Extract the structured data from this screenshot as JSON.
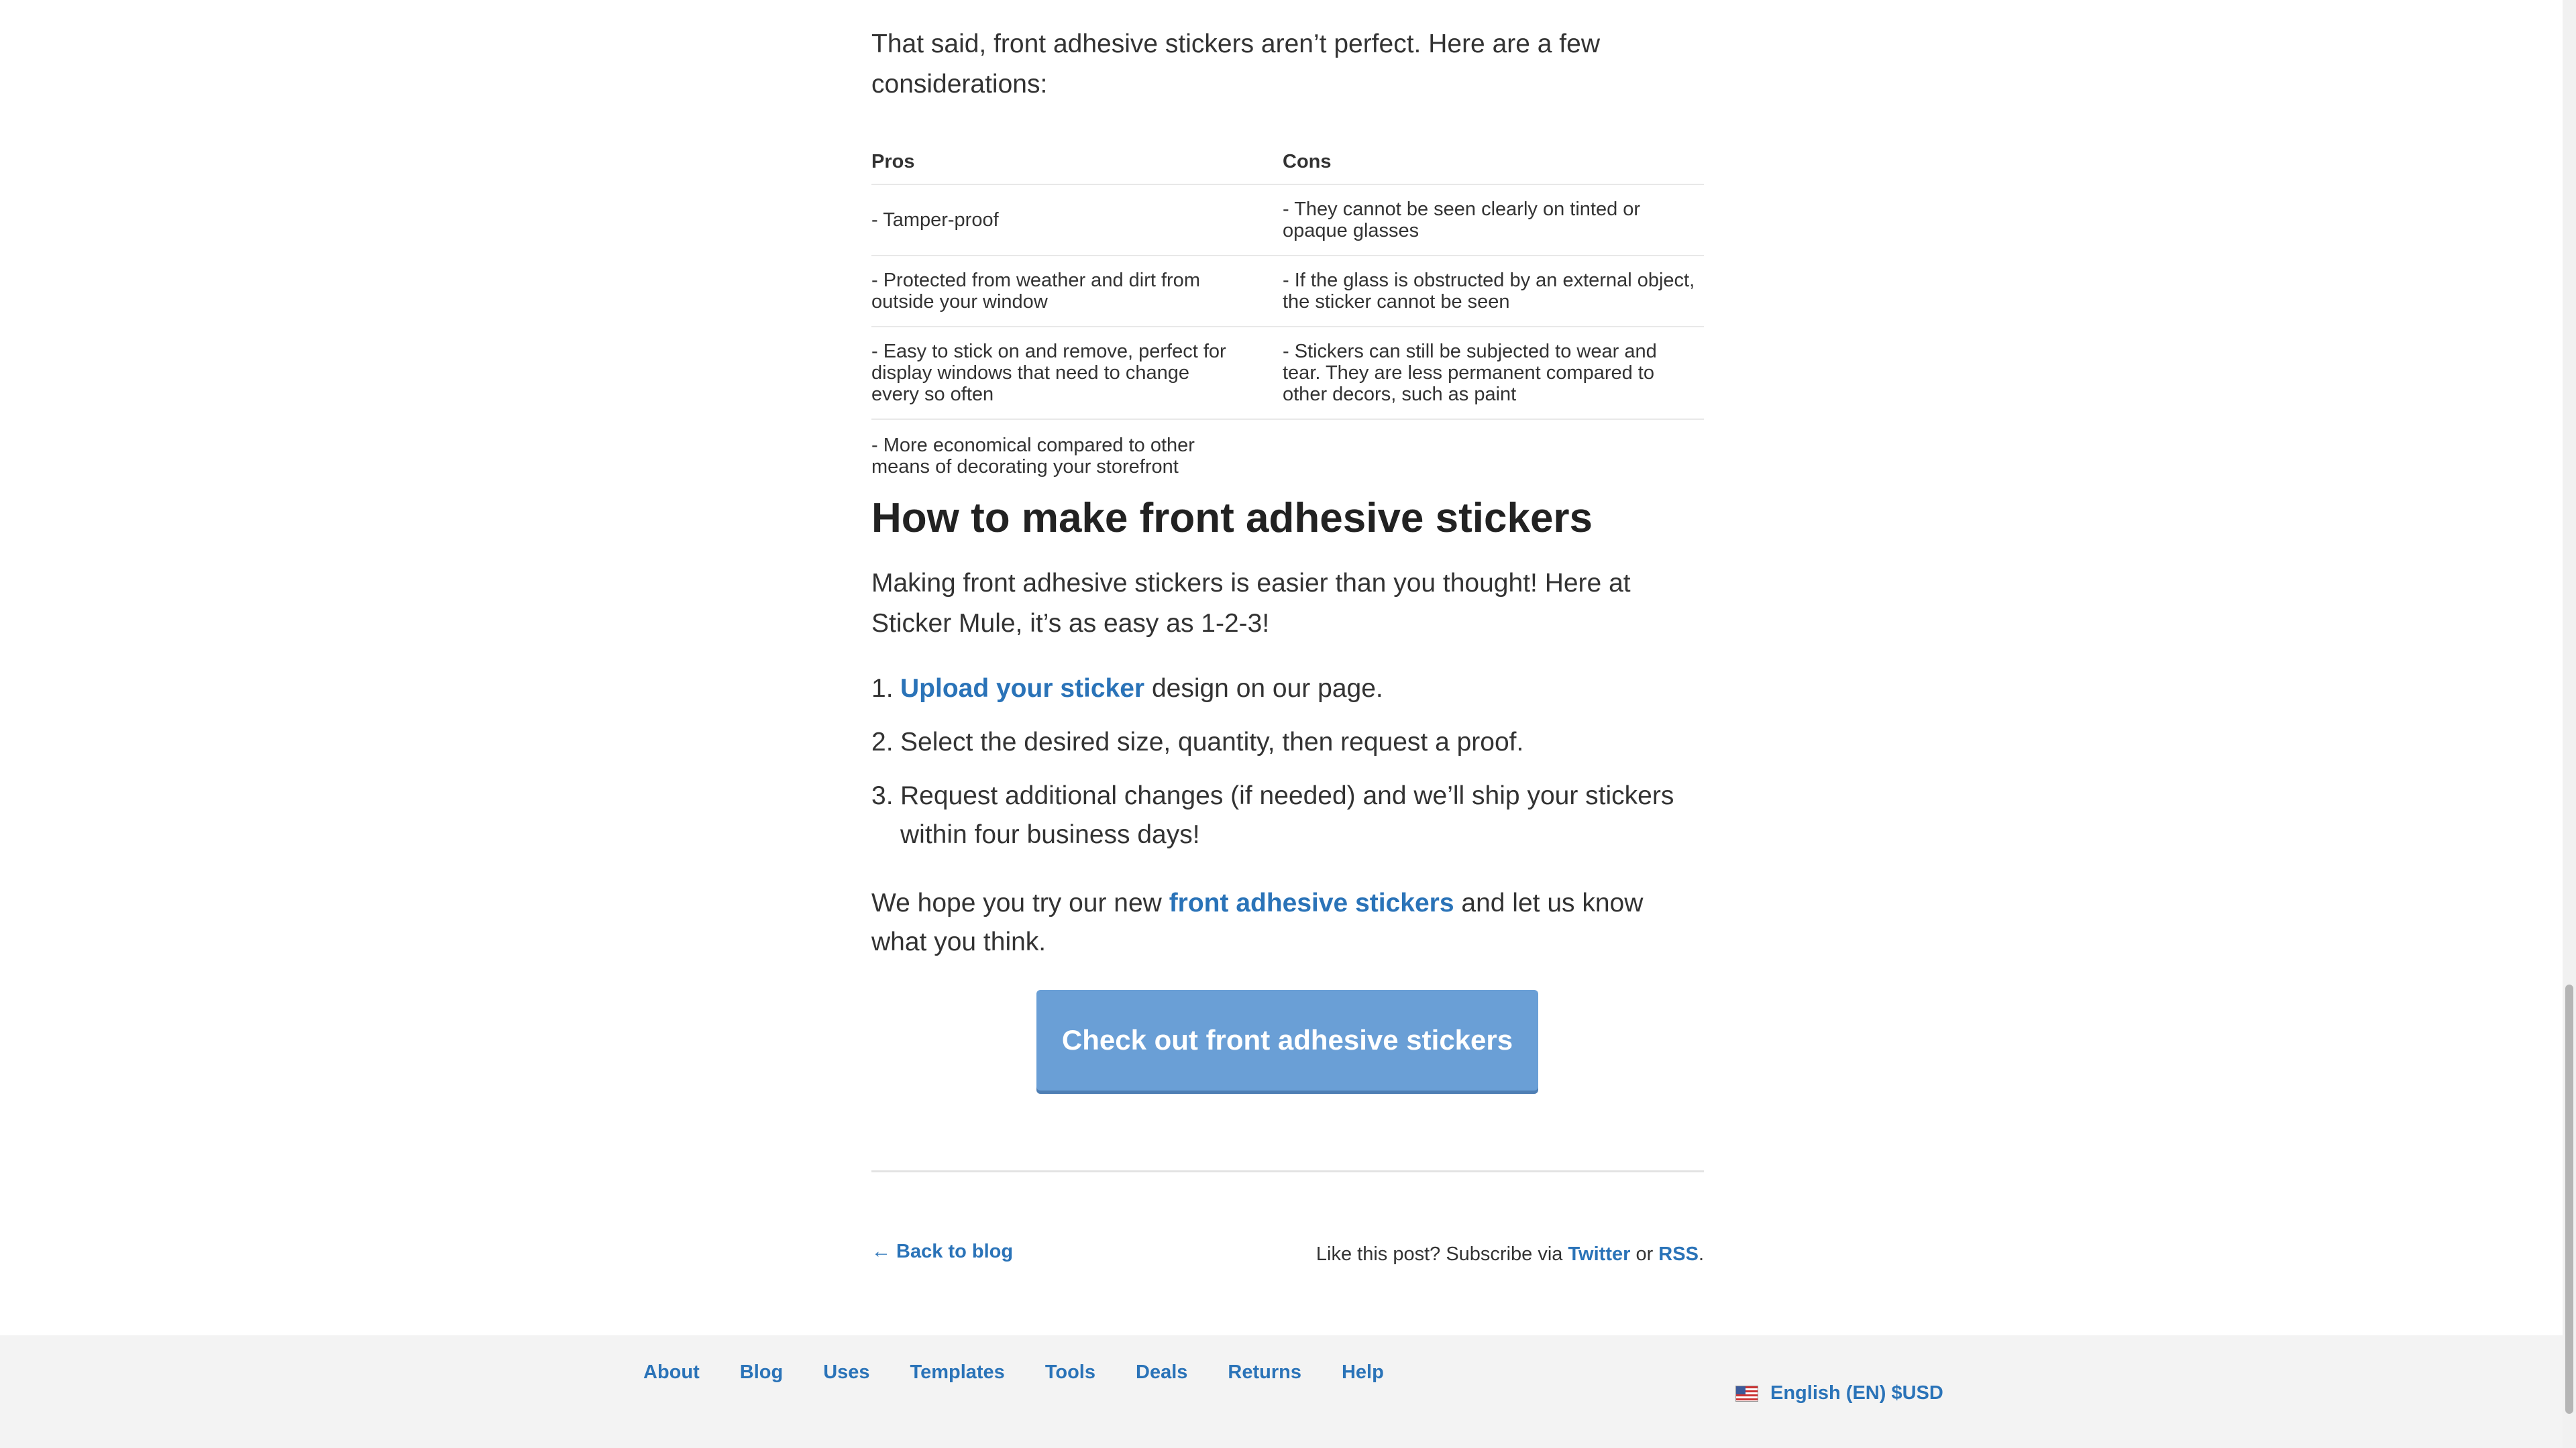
{
  "intro_text": "That said, front adhesive stickers aren’t perfect. Here are a few considerations:",
  "table": {
    "headers": {
      "pros": "Pros",
      "cons": "Cons"
    },
    "rows": [
      {
        "pro": "- Tamper-proof",
        "con": "- They cannot be seen clearly on tinted or opaque glasses"
      },
      {
        "pro": "- Protected from weather and dirt from outside your window",
        "con": "- If the glass is obstructed by an external object, the sticker cannot be seen"
      },
      {
        "pro": "- Easy to stick on and remove, perfect for display windows that need to change every so often",
        "con": "- Stickers can still be subjected to wear and tear. They are less permanent compared to other decors, such as paint"
      },
      {
        "pro": "- More economical compared to other means of decorating your storefront",
        "con": ""
      }
    ]
  },
  "howto": {
    "heading": "How to make front adhesive stickers",
    "paragraph": "Making front adhesive stickers is easier than you thought! Here at Sticker Mule, it’s as easy as 1-2-3!",
    "steps": [
      {
        "num": "1.",
        "link": "Upload your sticker",
        "text": " design on our page."
      },
      {
        "num": "2.",
        "text": "Select the desired size, quantity, then request a proof."
      },
      {
        "num": "3.",
        "text": "Request additional changes (if needed) and we’ll ship your stickers within four business days!"
      }
    ]
  },
  "closing": {
    "before": "We hope you try our new ",
    "link": "front adhesive stickers",
    "after": " and let us know what you think."
  },
  "cta_label": "Check out front adhesive stickers",
  "post_footer": {
    "back_link": "← Back to blog",
    "subscribe_prefix": "Like this post? Subscribe via ",
    "twitter": "Twitter",
    "or": " or ",
    "rss": "RSS",
    "period": "."
  },
  "footer": {
    "nav": [
      "About",
      "Blog",
      "Uses",
      "Templates",
      "Tools",
      "Deals",
      "Returns",
      "Help"
    ],
    "language": "English (EN) $USD",
    "flag_icon": "us-flag-icon"
  }
}
